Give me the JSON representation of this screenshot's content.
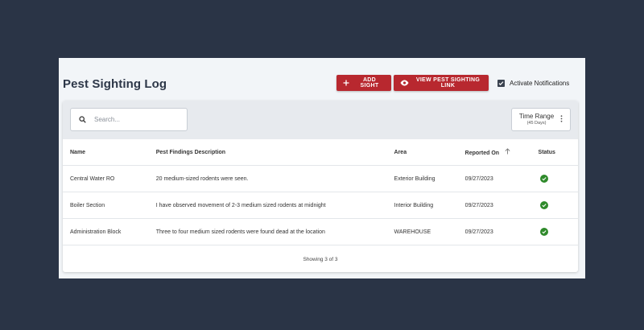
{
  "header": {
    "title": "Pest Sighting Log",
    "add_label": "ADD SIGHT",
    "view_label": "VIEW PEST SIGHTING LINK",
    "notify_label": "Activate Notifications",
    "notify_checked": true
  },
  "toolbar": {
    "search_placeholder": "Search...",
    "time_range_label": "Time Range",
    "time_range_sub": "(45 Days)"
  },
  "table": {
    "columns": [
      "Name",
      "Pest Findings Description",
      "Area",
      "Reported On",
      "Status"
    ],
    "rows": [
      {
        "name": "Central Water RO",
        "description": "20 medium-sized rodents were seen.",
        "area": "Exterior Building",
        "reported_on": "09/27/2023",
        "status": "resolved"
      },
      {
        "name": "Boiler Section",
        "description": "I have observed movement of 2-3 medium sized rodents at midnight",
        "area": "Interior Building",
        "reported_on": "09/27/2023",
        "status": "resolved"
      },
      {
        "name": "Administration Block",
        "description": "Three to four medium sized rodents were found dead at the location",
        "area": "WAREHOUSE",
        "reported_on": "09/27/2023",
        "status": "resolved"
      }
    ]
  },
  "footer": {
    "showing": "Showing 3 of 3"
  },
  "colors": {
    "accent": "#b8282f",
    "status_ok": "#2f8a2b",
    "background": "#2a3446"
  },
  "icons": {
    "add": "plus-icon",
    "view": "eye-icon",
    "search": "search-icon",
    "sort": "arrow-up-icon",
    "menu": "kebab-icon",
    "status": "check-circle-icon"
  }
}
